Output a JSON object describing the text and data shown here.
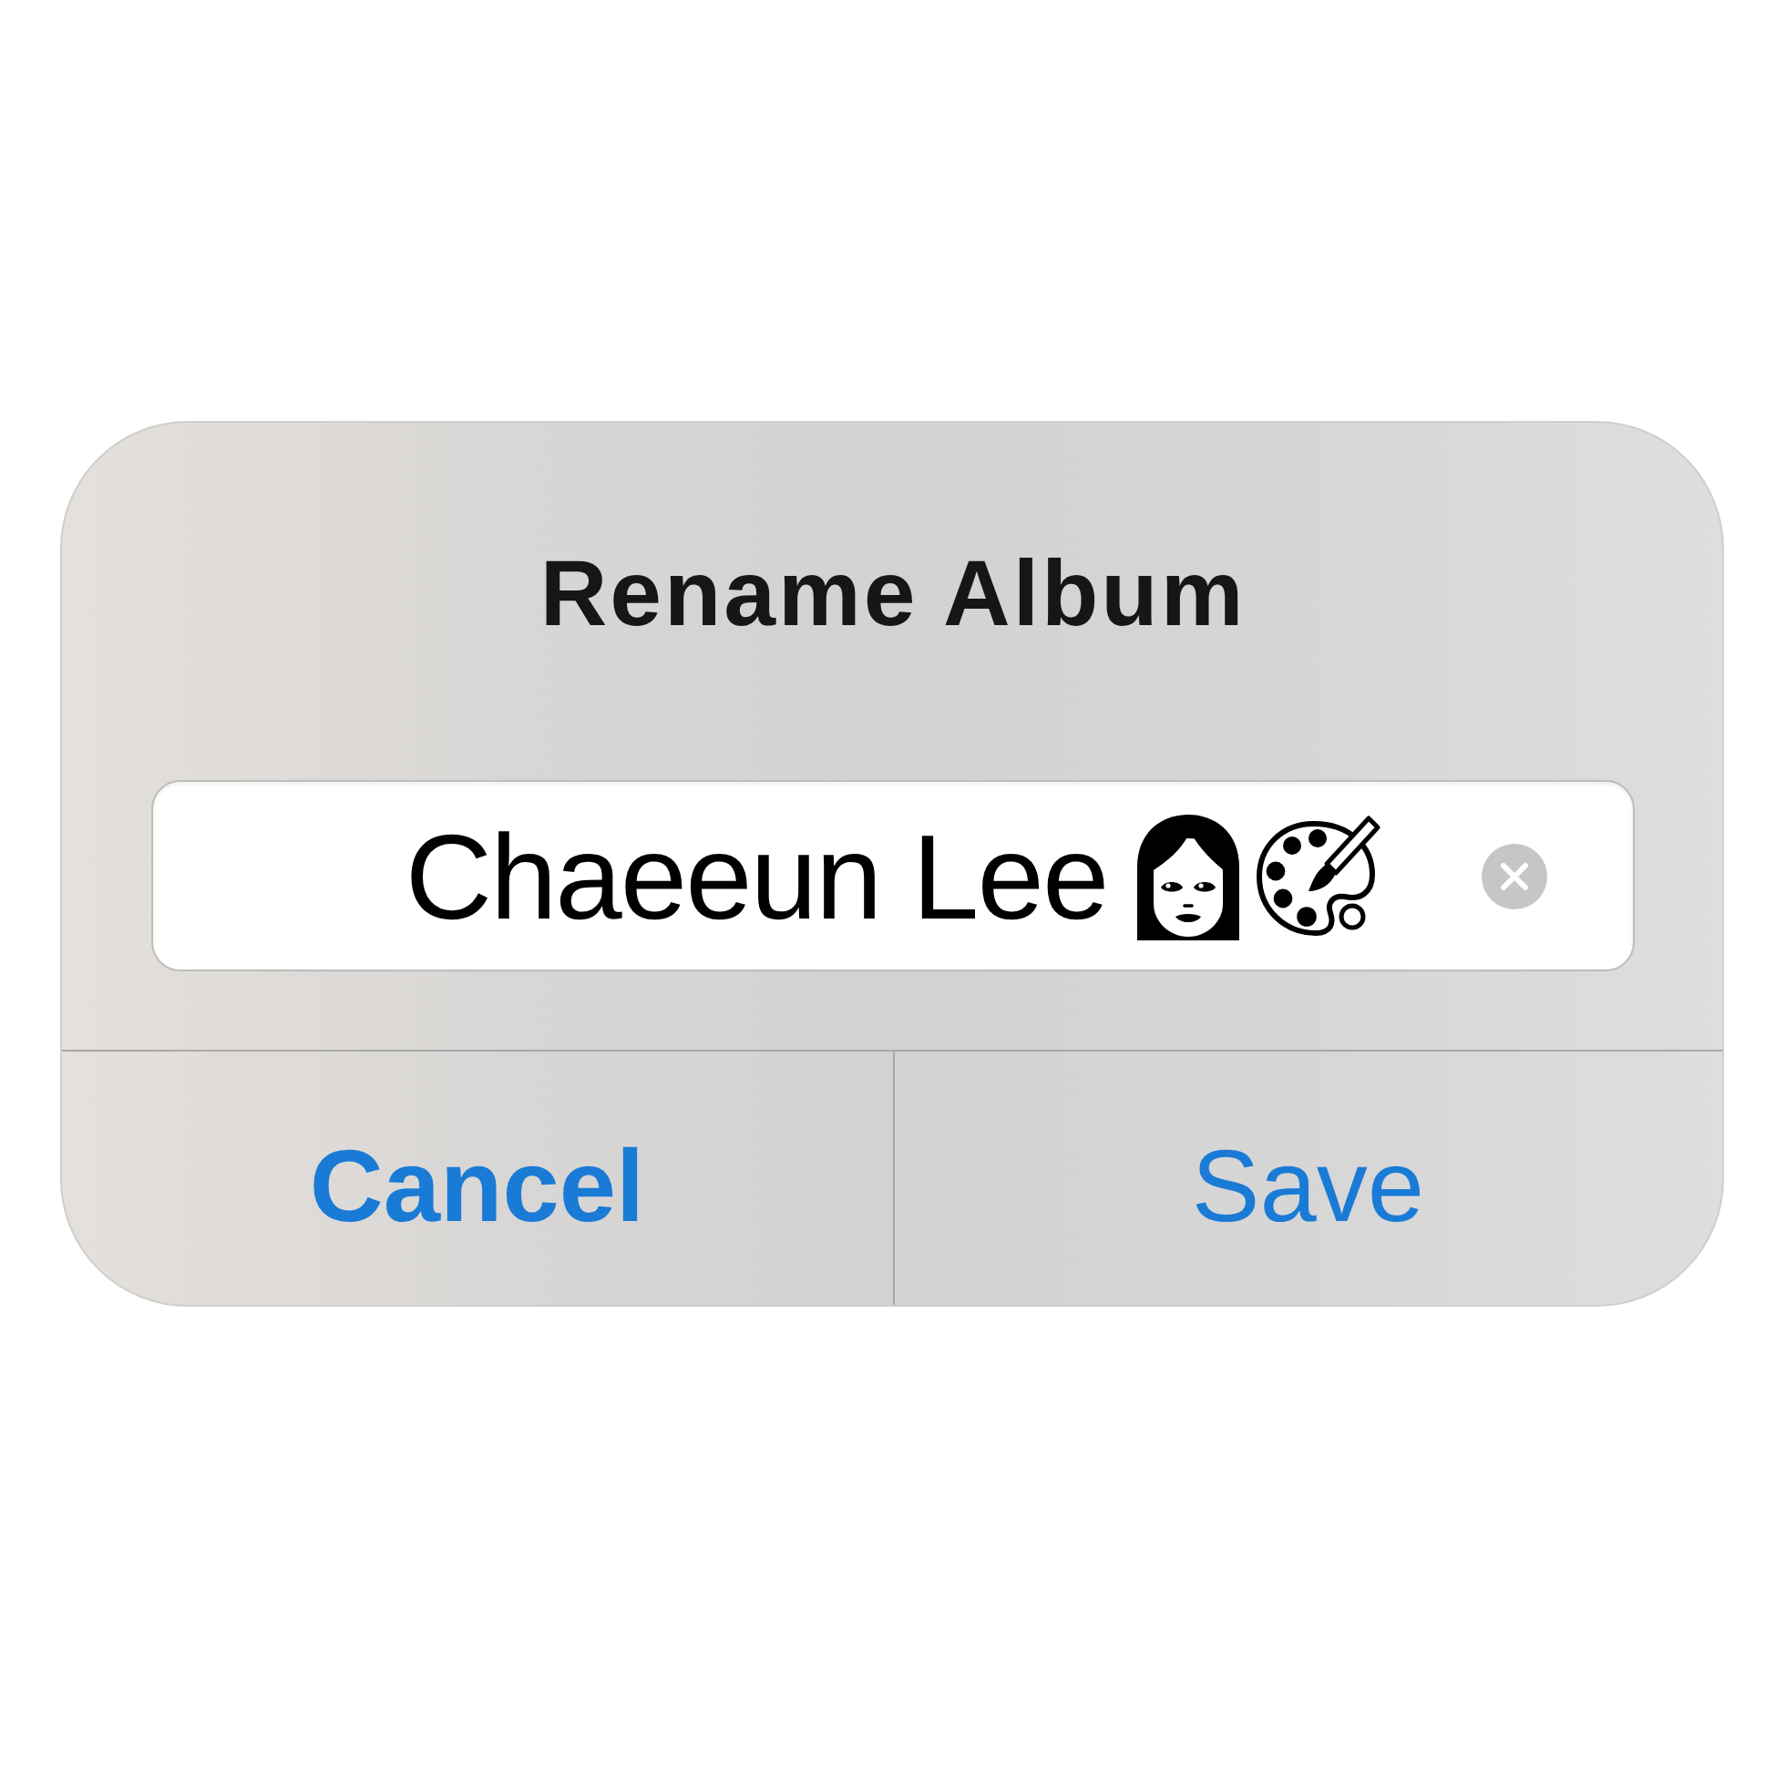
{
  "dialog": {
    "title": "Rename Album",
    "field": {
      "value": "Chaeeun Lee",
      "emojis": [
        {
          "kind": "woman"
        },
        {
          "kind": "palette"
        }
      ],
      "clear_button": true
    },
    "buttons": [
      {
        "label": "Cancel",
        "preferred": true
      },
      {
        "label": "Save",
        "preferred": false
      }
    ]
  }
}
